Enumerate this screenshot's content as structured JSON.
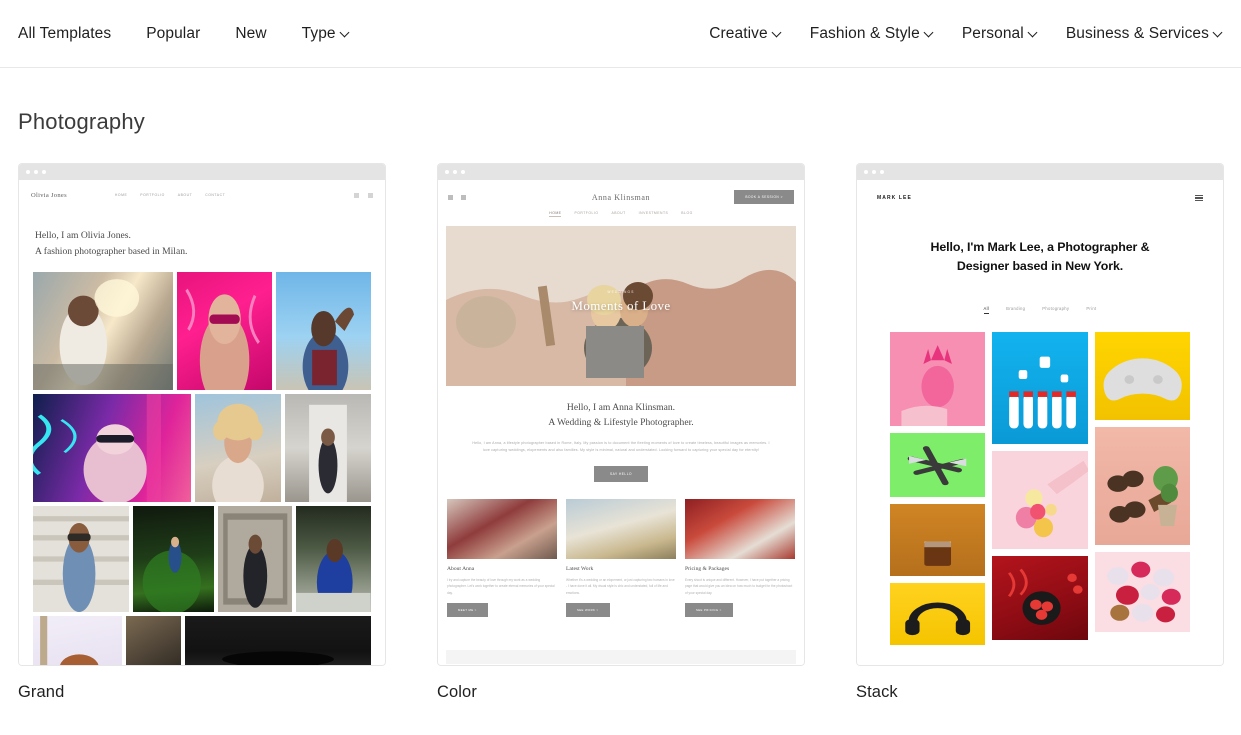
{
  "nav": {
    "left": [
      {
        "label": "All Templates",
        "caret": false
      },
      {
        "label": "Popular",
        "caret": false
      },
      {
        "label": "New",
        "caret": false
      },
      {
        "label": "Type",
        "caret": true
      }
    ],
    "right": [
      {
        "label": "Creative",
        "caret": true
      },
      {
        "label": "Fashion & Style",
        "caret": true
      },
      {
        "label": "Personal",
        "caret": true
      },
      {
        "label": "Business & Services",
        "caret": true
      }
    ]
  },
  "section": {
    "title": "Photography"
  },
  "cards": [
    {
      "label": "Grand",
      "site": {
        "brand": "Olivia Jones",
        "links": [
          "HOME",
          "PORTFOLIO",
          "ABOUT",
          "CONTACT"
        ],
        "icons": [
          "cart-icon",
          "search-icon"
        ],
        "hero_line1": "Hello, I am Olivia Jones.",
        "hero_line2": "A fashion photographer based in Milan."
      }
    },
    {
      "label": "Color",
      "site": {
        "brand": "Anna Klinsman",
        "links": [
          "HOME",
          "PORTFOLIO",
          "ABOUT",
          "INVESTMENTS",
          "BLOG"
        ],
        "cta": "BOOK A SESSION >",
        "hero_kicker": "WEDDINGS",
        "hero_caption": "Moments of Love",
        "about_line1": "Hello, I am Anna Klinsman.",
        "about_line2": "A Wedding & Lifestyle Photographer.",
        "about_body": "Hello, I am Anna, a lifestyle photographer based in Rome, Italy. My passion is to document the fleeting moments of love to create timeless, beautiful images as memories. I love capturing weddings, elopements and also families. My style is minimal, natural and understated. Looking forward to capturing your special day for eternity!",
        "about_cta": "SAY HELLO",
        "columns": [
          {
            "title": "About Anna",
            "body": "I try and capture the beauty of love through my work as a wedding photographer. Let's work together to create eternal memories of your special day.",
            "button": "MEET ME >"
          },
          {
            "title": "Latest Work",
            "body": "Whether it's a wedding or an elopement, or just capturing two humans in love - I have done it all. My visual style is chic and understated, full of life and emotions.",
            "button": "SEE WORK >"
          },
          {
            "title": "Pricing & Packages",
            "body": "Every shoot is unique and different. However, I have put together a pricing page that would give you an idea on how much to budget for the photoshoot of your special day.",
            "button": "SEE PRICING >"
          }
        ]
      }
    },
    {
      "label": "Stack",
      "site": {
        "brand": "MARK LEE",
        "menu_icon": "hamburger-icon",
        "hero": "Hello, I'm Mark Lee, a Photographer & Designer based in New York.",
        "filters": [
          "All",
          "Branding",
          "Photography",
          "Print"
        ]
      }
    }
  ],
  "colors": {
    "chrome": "#e4e4e4",
    "border": "#e6e6e6",
    "text": "#1f1f1f",
    "muted": "#9a9a9a"
  }
}
